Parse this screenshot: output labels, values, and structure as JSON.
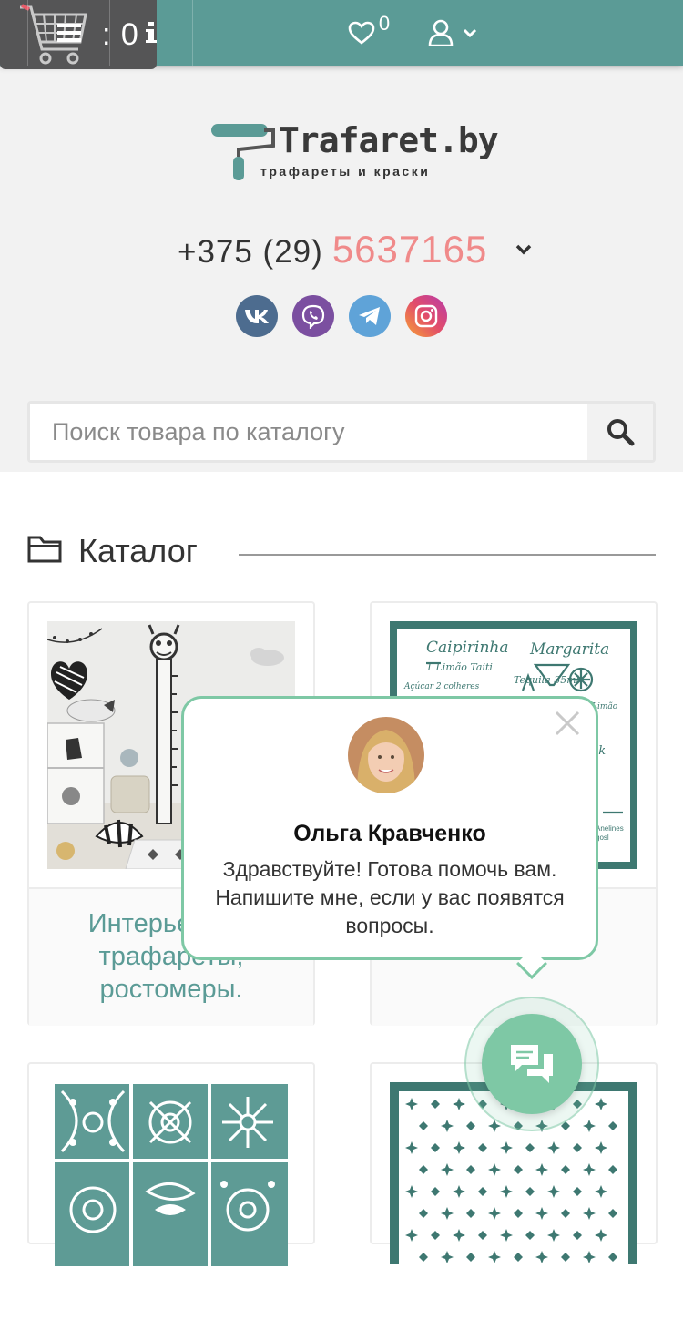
{
  "topbar": {
    "favorites_count": "0",
    "cart_count": ": 0"
  },
  "header": {
    "logo_title": "Trafaret.by",
    "logo_subtitle": "трафареты и краски",
    "phone_prefix": "+375 (29)",
    "phone_number": "5637165",
    "socials": [
      "vk",
      "viber",
      "telegram",
      "instagram"
    ]
  },
  "search": {
    "placeholder": "Поиск товара по каталогу"
  },
  "catalog": {
    "title": "Каталог",
    "items": [
      {
        "caption": "Интерьерные трафареты, ростомеры."
      },
      {
        "caption": ""
      },
      {
        "caption": ""
      },
      {
        "caption": ""
      }
    ],
    "card2_lettering": [
      "Caipirinha",
      "Margarita",
      "1 Limão Taiti",
      "Açúcar 2 colheres",
      "Tequila 35ml",
      "Limão",
      "ck"
    ]
  },
  "chat": {
    "agent_name": "Ольга Кравченко",
    "message": "Здравствуйте! Готова помочь вам. Напишите мне, если у вас появятся вопросы."
  },
  "colors": {
    "brand_teal": "#5b9b96",
    "cart_bg": "#555556",
    "phone_accent": "#f08a8a",
    "chat_green": "#7ec8a5"
  }
}
